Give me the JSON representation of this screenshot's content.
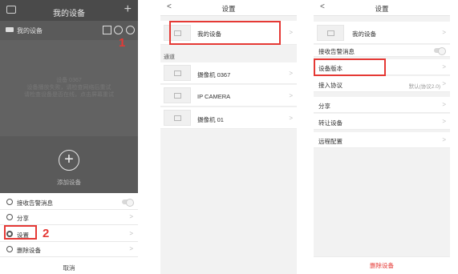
{
  "panel1": {
    "header_title": "我的设备",
    "device_name": "我的设备",
    "overlay_faint_lines": [
      "设备 0367",
      "设备播放失败，请检查网络后重试",
      "请检查设备是否在线，点击屏幕重试"
    ],
    "add_device_label": "添加设备",
    "sheet_items": [
      {
        "label": "接收告警消息",
        "type": "toggle"
      },
      {
        "label": "分享",
        "type": "arrow"
      },
      {
        "label": "设置",
        "type": "arrow"
      },
      {
        "label": "删除设备",
        "type": "arrow"
      }
    ],
    "cancel_label": "取消",
    "callouts": [
      "1",
      "2"
    ]
  },
  "panel2": {
    "title": "设置",
    "back": "<",
    "my_device_label": "我的设备",
    "section_label": "通道",
    "channels": [
      "摄像机 0367",
      "IP CAMERA",
      "摄像机 01"
    ]
  },
  "panel3": {
    "title": "设置",
    "back": "<",
    "my_device_label": "我的设备",
    "alarm_label": "接收告警消息",
    "version_label": "设备版本",
    "protocol_label": "接入协议",
    "protocol_value": "默认(协议2.0)",
    "share_label": "分享",
    "transfer_label": "转让设备",
    "remote_label": "远程配置",
    "delete_label": "删除设备"
  },
  "arrow_glyph": ">",
  "colors": {
    "accent_red": "#e53935",
    "overlay_dark": "#5a5a5a"
  }
}
